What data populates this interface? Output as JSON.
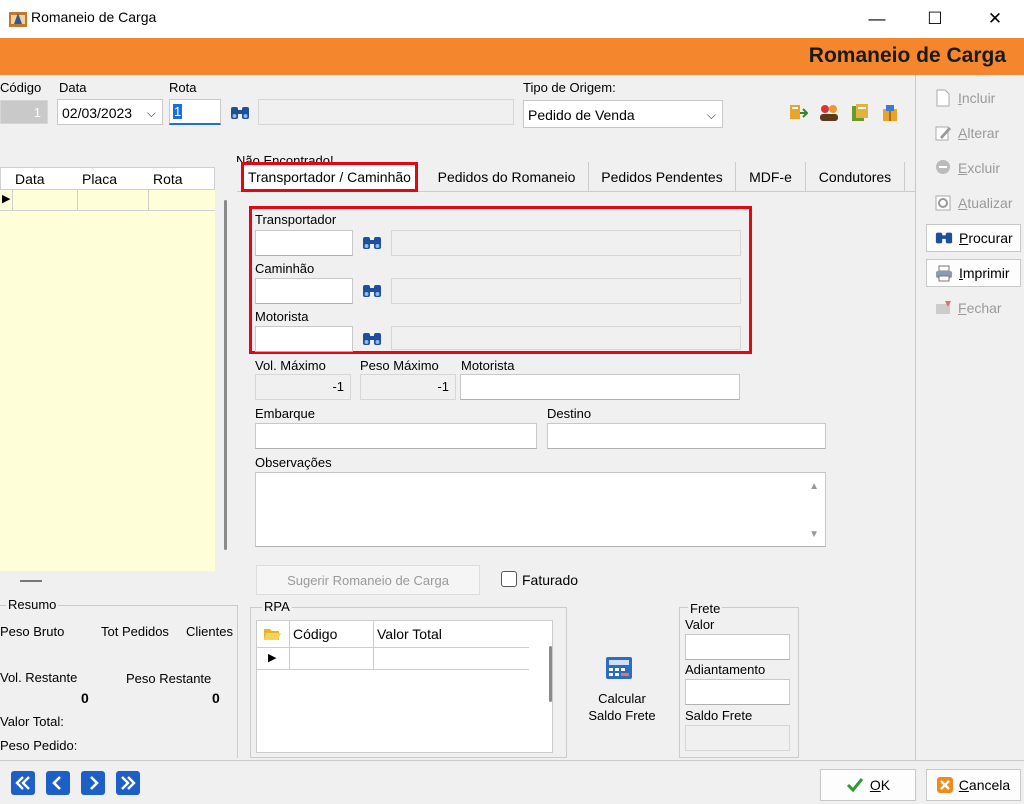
{
  "window": {
    "title": "Romaneio de Carga",
    "minimize": "—",
    "maximize": "☐",
    "close": "✕"
  },
  "header": {
    "title": "Romaneio de Carga"
  },
  "top": {
    "codigo_label": "Código",
    "codigo_value": "1",
    "data_label": "Data",
    "data_value": "02/03/2023",
    "rota_label": "Rota",
    "rota_value": "1",
    "tipo_origem_label": "Tipo de Origem:",
    "tipo_origem_value": "Pedido de Venda",
    "nao_encontrado": "Não Encontrado!"
  },
  "left_grid": {
    "columns": [
      "Data",
      "Placa",
      "Rota"
    ]
  },
  "tabs": [
    "Transportador / Caminhão",
    "Pedidos do Romaneio",
    "Pedidos Pendentes",
    "MDF-e",
    "Condutores"
  ],
  "form": {
    "transportador_label": "Transportador",
    "caminhao_label": "Caminhão",
    "motorista_label": "Motorista",
    "vol_maximo_label": "Vol. Máximo",
    "vol_maximo_value": "-1",
    "peso_maximo_label": "Peso Máximo",
    "peso_maximo_value": "-1",
    "motorista2_label": "Motorista",
    "embarque_label": "Embarque",
    "destino_label": "Destino",
    "observacoes_label": "Observações",
    "sugerir_button": "Sugerir Romaneio de Carga",
    "faturado_label": "Faturado"
  },
  "resumo": {
    "title": "Resumo",
    "peso_bruto": "Peso Bruto",
    "tot_pedidos": "Tot Pedidos",
    "clientes": "Clientes",
    "vol_restante": "Vol. Restante",
    "vol_restante_value": "0",
    "peso_restante": "Peso Restante",
    "peso_restante_value": "0",
    "valor_total": "Valor Total:",
    "peso_pedido": "Peso Pedido:"
  },
  "rpa": {
    "title": "RPA",
    "columns": [
      "Código",
      "Valor Total"
    ]
  },
  "frete": {
    "title": "Frete",
    "valor_label": "Valor",
    "adiantamento_label": "Adiantamento",
    "saldo_label": "Saldo Frete",
    "calcular_line1": "Calcular",
    "calcular_line2": "Saldo Frete"
  },
  "side": [
    {
      "label": "Incluir",
      "key": "I",
      "rest": "ncluir",
      "enabled": false
    },
    {
      "label": "Alterar",
      "key": "A",
      "rest": "lterar",
      "enabled": false
    },
    {
      "label": "Excluir",
      "key": "E",
      "rest": "xcluir",
      "enabled": false
    },
    {
      "label": "Atualizar",
      "key": "A",
      "rest": "tualizar",
      "enabled": false
    },
    {
      "label": "Procurar",
      "key": "P",
      "rest": "rocurar",
      "enabled": true
    },
    {
      "label": "Imprimir",
      "key": "I",
      "rest": "mprimir",
      "enabled": true
    },
    {
      "label": "Fechar",
      "key": "F",
      "rest": "echar",
      "enabled": false
    }
  ],
  "bottom": {
    "ok_key": "O",
    "ok_rest": "K",
    "cancel_key": "C",
    "cancel_rest": "ancela"
  },
  "colors": {
    "orange": "#f4862d",
    "yellow_grid": "#fefed8",
    "highlight_red": "#e30613",
    "nav_blue": "#1c5fc7"
  }
}
